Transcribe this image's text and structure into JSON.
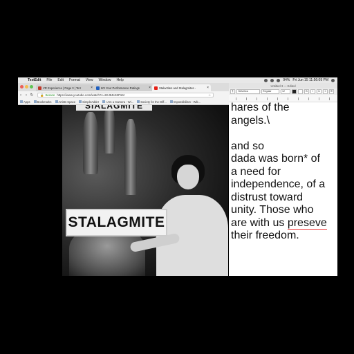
{
  "menubar": {
    "app": "TextEdit",
    "items": [
      "File",
      "Edit",
      "Format",
      "View",
      "Window",
      "Help"
    ],
    "battery": "94%",
    "datetime": "Fri Jun 15  11:56:09 PM"
  },
  "chrome": {
    "tabs": [
      {
        "label": "VR Experience | Page 3 | Terr",
        "favicon_color": "#c0392b"
      },
      {
        "label": "60! Your Performance Ratings",
        "favicon_color": "#1f5fbf"
      },
      {
        "label": "Stalactites and Stalagmites -",
        "favicon_color": "#e62117"
      }
    ],
    "address": {
      "secure_label": "Secure",
      "url": "https://www.youtube.com/watch?v=2KJ84sS3PsM"
    },
    "bookmarks": [
      "Apps",
      "Bookmarks",
      "Artists Space",
      "SimpleAdder",
      "I Am a Camera - Wi...",
      "Society for the Diff...",
      "Impossibilism - Wik..."
    ]
  },
  "video": {
    "top_sign": "SIALAGMITE",
    "sign": "STALAGMITE"
  },
  "textedit": {
    "title": "Untitled 3 — Edited",
    "font": "Helvetica",
    "style": "Regular",
    "size": "12",
    "lines": [
      "hares of the",
      "angels.\\",
      "",
      "and so",
      "dada was born* of",
      "a need for",
      "independence, of a",
      "distrust toward",
      "unity. Those who",
      "are with us ",
      "their freedom."
    ],
    "misspelled": "preseve"
  }
}
